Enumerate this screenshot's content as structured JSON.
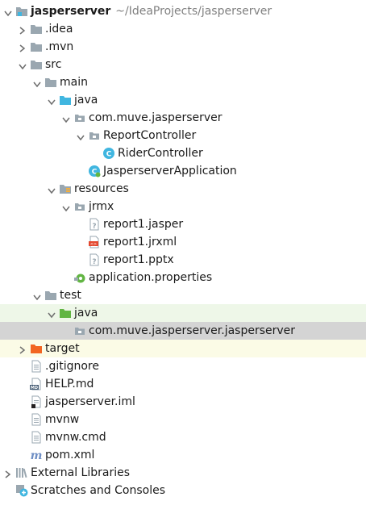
{
  "project": {
    "name": "jasperserver",
    "path": "~/IdeaProjects/jasperserver"
  },
  "nodes": [
    {
      "label": "jasperserver",
      "icon": "module-icon",
      "arrow": "down",
      "depth": 0,
      "bold": true,
      "path": "~/IdeaProjects/jasperserver"
    },
    {
      "label": ".idea",
      "icon": "folder-icon",
      "arrow": "right",
      "depth": 1
    },
    {
      "label": ".mvn",
      "icon": "folder-icon",
      "arrow": "right",
      "depth": 1
    },
    {
      "label": "src",
      "icon": "folder-icon",
      "arrow": "down",
      "depth": 1
    },
    {
      "label": "main",
      "icon": "folder-icon",
      "arrow": "down",
      "depth": 2
    },
    {
      "label": "java",
      "icon": "source-folder-icon",
      "arrow": "down",
      "depth": 3
    },
    {
      "label": "com.muve.jasperserver",
      "icon": "package-icon",
      "arrow": "down",
      "depth": 4
    },
    {
      "label": "ReportController",
      "icon": "package-icon",
      "arrow": "down",
      "depth": 5
    },
    {
      "label": "RiderController",
      "icon": "class-icon",
      "arrow": "none",
      "depth": 6
    },
    {
      "label": "JasperserverApplication",
      "icon": "spring-class-icon",
      "arrow": "none",
      "depth": 5
    },
    {
      "label": "resources",
      "icon": "resources-folder-icon",
      "arrow": "down",
      "depth": 3
    },
    {
      "label": "jrmx",
      "icon": "package-icon",
      "arrow": "down",
      "depth": 4
    },
    {
      "label": "report1.jasper",
      "icon": "unknown-file-icon",
      "arrow": "none",
      "depth": 5
    },
    {
      "label": "report1.jrxml",
      "icon": "xml-file-icon",
      "arrow": "none",
      "depth": 5
    },
    {
      "label": "report1.pptx",
      "icon": "unknown-file-icon",
      "arrow": "none",
      "depth": 5
    },
    {
      "label": "application.properties",
      "icon": "properties-file-icon",
      "arrow": "none",
      "depth": 4
    },
    {
      "label": "test",
      "icon": "folder-icon",
      "arrow": "down",
      "depth": 2
    },
    {
      "label": "java",
      "icon": "test-folder-icon",
      "arrow": "down",
      "depth": 3,
      "bg": "test"
    },
    {
      "label": "com.muve.jasperserver.jasperserver",
      "icon": "package-icon",
      "arrow": "none",
      "depth": 4,
      "bg": "selected"
    },
    {
      "label": "target",
      "icon": "excluded-folder-icon",
      "arrow": "right",
      "depth": 1,
      "bg": "excluded"
    },
    {
      "label": ".gitignore",
      "icon": "text-file-icon",
      "arrow": "none",
      "depth": 1
    },
    {
      "label": "HELP.md",
      "icon": "markdown-file-icon",
      "arrow": "none",
      "depth": 1
    },
    {
      "label": "jasperserver.iml",
      "icon": "iml-file-icon",
      "arrow": "none",
      "depth": 1
    },
    {
      "label": "mvnw",
      "icon": "text-file-icon",
      "arrow": "none",
      "depth": 1
    },
    {
      "label": "mvnw.cmd",
      "icon": "text-file-icon",
      "arrow": "none",
      "depth": 1
    },
    {
      "label": "pom.xml",
      "icon": "maven-icon",
      "arrow": "none",
      "depth": 1
    },
    {
      "label": "External Libraries",
      "icon": "libraries-icon",
      "arrow": "right",
      "depth": 0
    },
    {
      "label": "Scratches and Consoles",
      "icon": "scratches-icon",
      "arrow": "none",
      "depth": 0
    }
  ],
  "colors": {
    "folder": "#9aa7b0",
    "source_folder": "#40b6e0",
    "test_folder": "#62b543",
    "excluded_folder": "#f26522",
    "class": "#40b6e0",
    "selected_bg": "#d4d4d4",
    "test_bg": "#eef7e8",
    "excluded_bg": "#fbfbe6"
  }
}
